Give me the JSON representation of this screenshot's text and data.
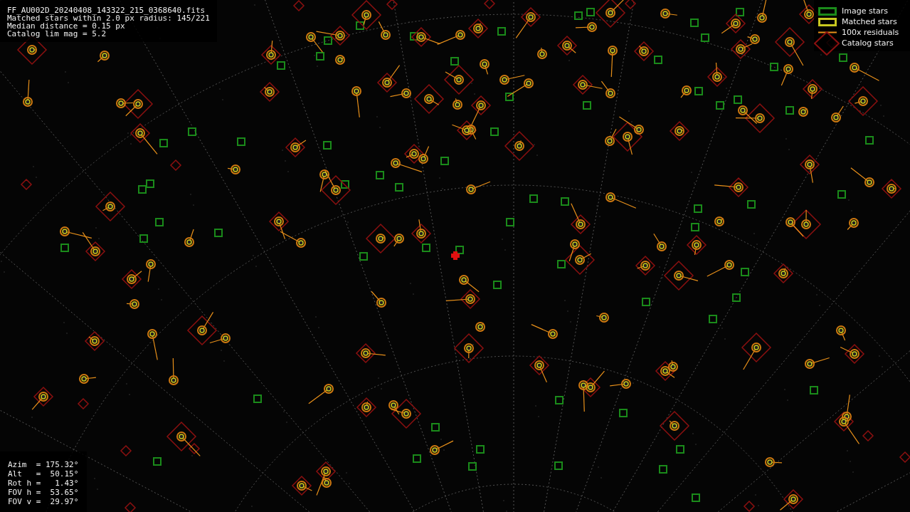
{
  "file_info": [
    "FF_AU002D_20240408_143322_215_0368640.fits",
    "Matched stars within 2.0 px radius: 145/221",
    "Median distance = 0.15 px",
    "Catalog lim mag = 5.2"
  ],
  "legend": [
    {
      "kind": "image",
      "label": "Image stars"
    },
    {
      "kind": "matched",
      "label": "Matched stars"
    },
    {
      "kind": "residual",
      "label": "100x residuals"
    },
    {
      "kind": "catalog",
      "label": "Catalog stars"
    }
  ],
  "view_info": [
    "Azim  = 175.32°",
    "Alt   =  50.15°",
    "Rot h =   1.43°",
    "FOV h =  53.65°",
    "FOV v =  29.97°"
  ]
}
